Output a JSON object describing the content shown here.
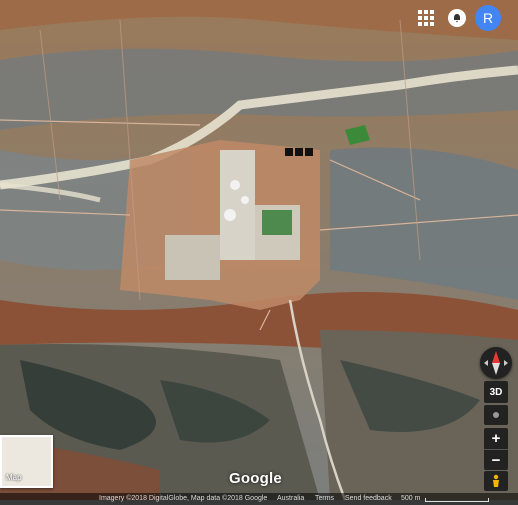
{
  "topbar": {
    "avatar_letter": "R"
  },
  "minimap": {
    "label": "Map"
  },
  "controls": {
    "btn_3d": "3D",
    "zoom_in": "+",
    "zoom_out": "−"
  },
  "logo": {
    "text": "Google"
  },
  "footer": {
    "imagery": "Imagery ©2018 DigitalGlobe, Map data ©2018 Google",
    "country": "Australia",
    "terms": "Terms",
    "feedback": "Send feedback",
    "scale": "500 m"
  },
  "colors": {
    "avatar": "#4285f4",
    "map_control": "#222222"
  }
}
